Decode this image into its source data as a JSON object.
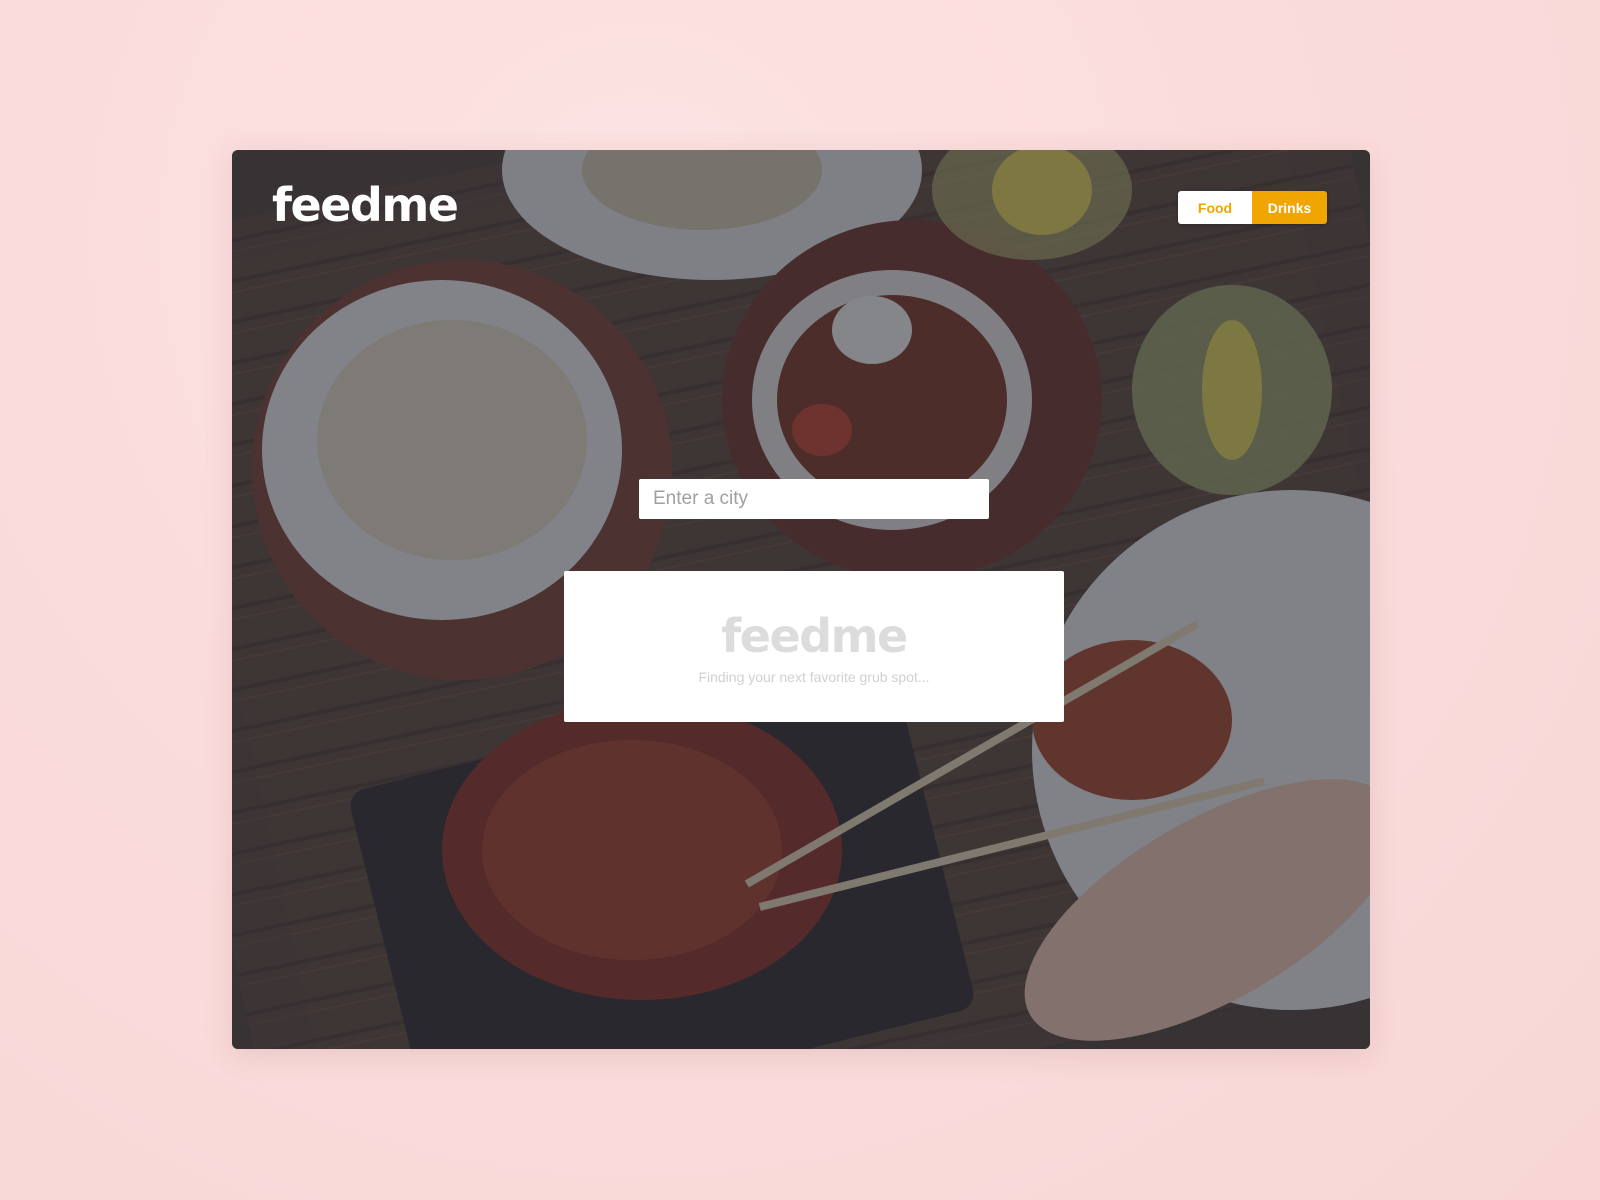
{
  "app": {
    "logo_text": "feedme"
  },
  "header": {
    "toggle": {
      "food_label": "Food",
      "drinks_label": "Drinks",
      "active": "drinks"
    }
  },
  "search": {
    "placeholder": "Enter a city",
    "value": ""
  },
  "loading_card": {
    "logo_text": "feedme",
    "tagline": "Finding your next favorite grub spot..."
  },
  "colors": {
    "accent": "#f0a500",
    "page_background": "#fbdcdc",
    "overlay": "#282c3a"
  }
}
